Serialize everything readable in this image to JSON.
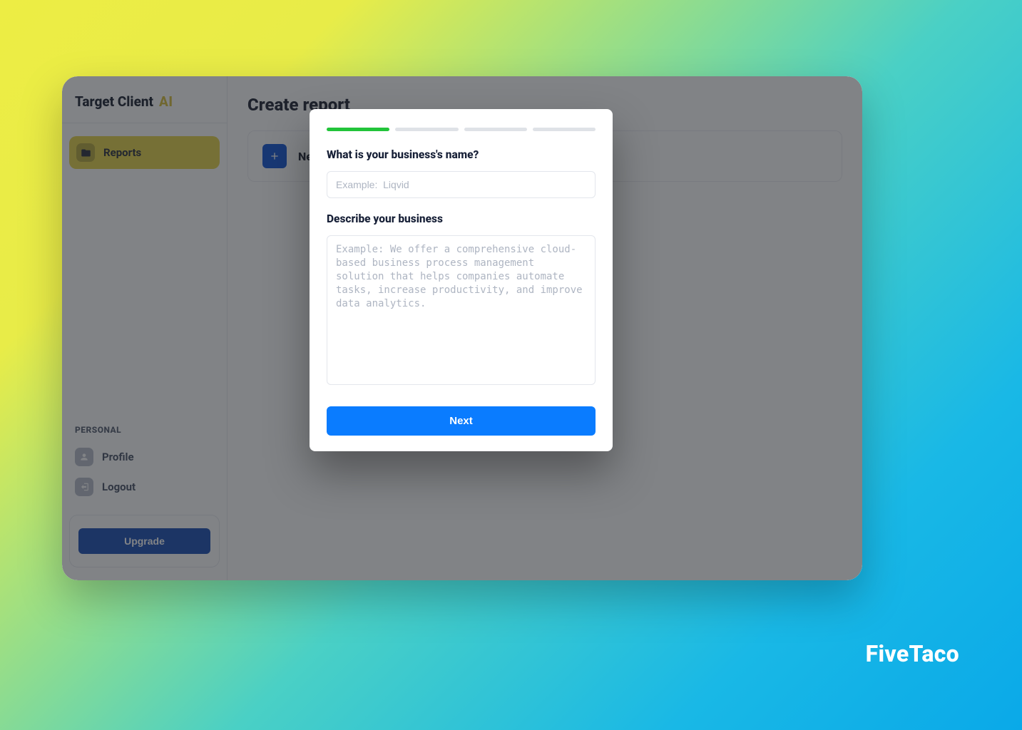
{
  "brand": {
    "main": "Target Client",
    "suffix": "AI"
  },
  "sidebar": {
    "nav": [
      {
        "label": "Reports",
        "active": true
      }
    ],
    "personal_label": "PERSONAL",
    "personal": [
      {
        "label": "Profile"
      },
      {
        "label": "Logout"
      }
    ],
    "upgrade_label": "Upgrade"
  },
  "main": {
    "title": "Create report",
    "new_report_label": "New Report"
  },
  "modal": {
    "steps_total": 4,
    "steps_done": 1,
    "q1_label": "What is your business's name?",
    "q1_placeholder": "Example:  Liqvid",
    "q2_label": "Describe your business",
    "q2_placeholder": "Example: We offer a comprehensive cloud-based business process management solution that helps companies automate tasks, increase productivity, and improve data analytics.",
    "next_label": "Next"
  },
  "footer": {
    "brand": "FiveTaco"
  }
}
